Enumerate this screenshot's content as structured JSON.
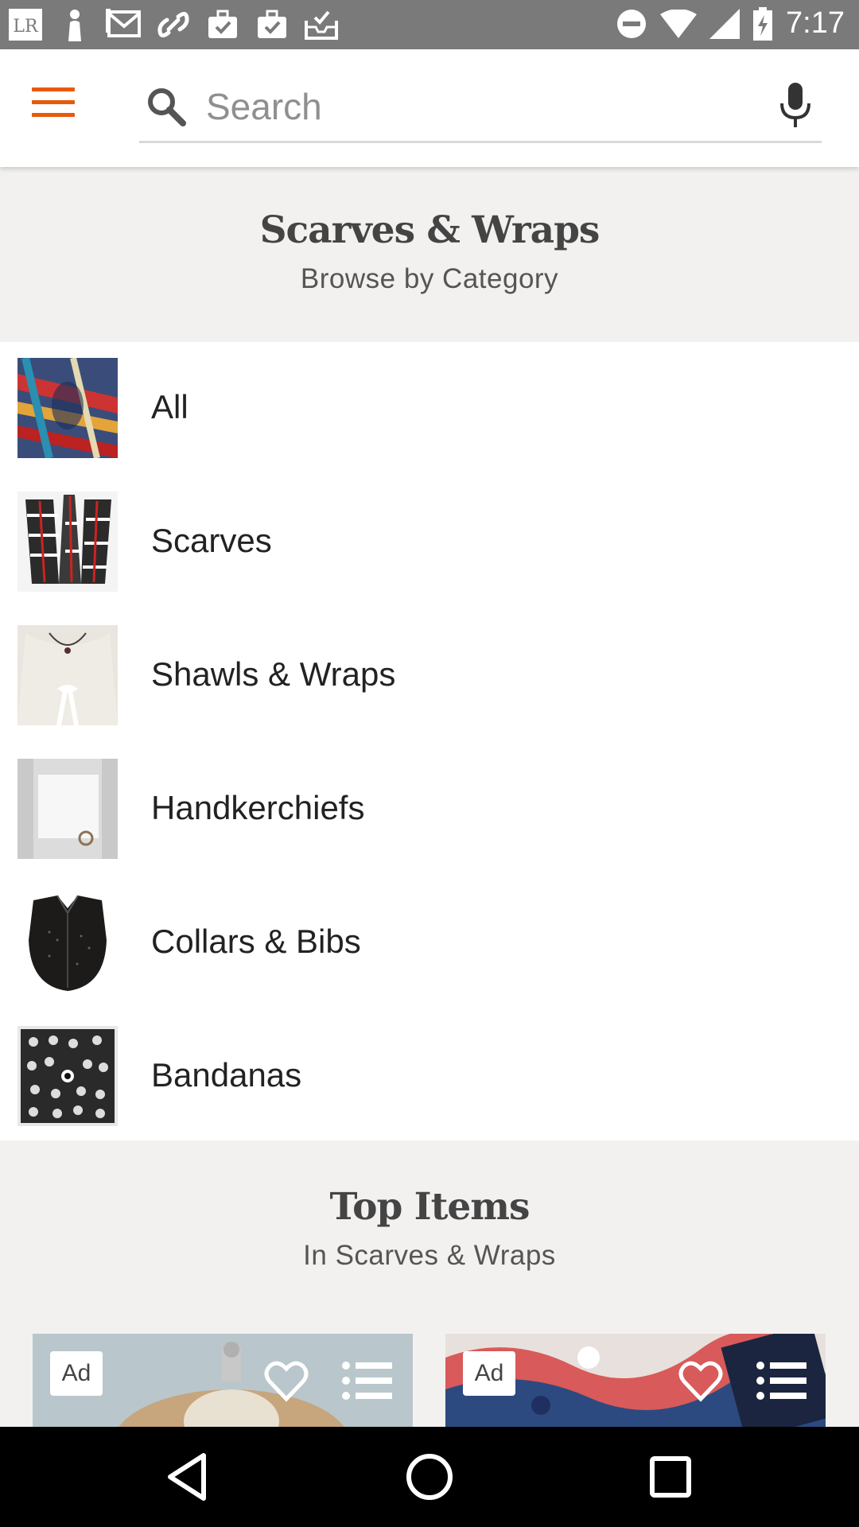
{
  "status_bar": {
    "time": "7:17",
    "left_icons": [
      "lr-app-icon",
      "person-icon",
      "gmail-icon",
      "link-icon",
      "briefcase-check-icon",
      "briefcase-check-icon",
      "inbox-check-icon"
    ],
    "right_icons": [
      "do-not-disturb-icon",
      "wifi-icon",
      "signal-icon",
      "battery-charging-icon"
    ],
    "lr_label": "LR"
  },
  "app_bar": {
    "search_placeholder": "Search",
    "accent_color": "#e8590c"
  },
  "category_header": {
    "title": "Scarves & Wraps",
    "subtitle": "Browse by Category"
  },
  "categories": [
    {
      "label": "All"
    },
    {
      "label": "Scarves"
    },
    {
      "label": "Shawls & Wraps"
    },
    {
      "label": "Handkerchiefs"
    },
    {
      "label": "Collars & Bibs"
    },
    {
      "label": "Bandanas"
    }
  ],
  "top_items": {
    "title": "Top Items",
    "subtitle": "In Scarves & Wraps",
    "cards": [
      {
        "badge": "Ad"
      },
      {
        "badge": "Ad"
      }
    ]
  },
  "nav_bar": {
    "buttons": [
      "back-icon",
      "home-icon",
      "recents-icon"
    ]
  }
}
